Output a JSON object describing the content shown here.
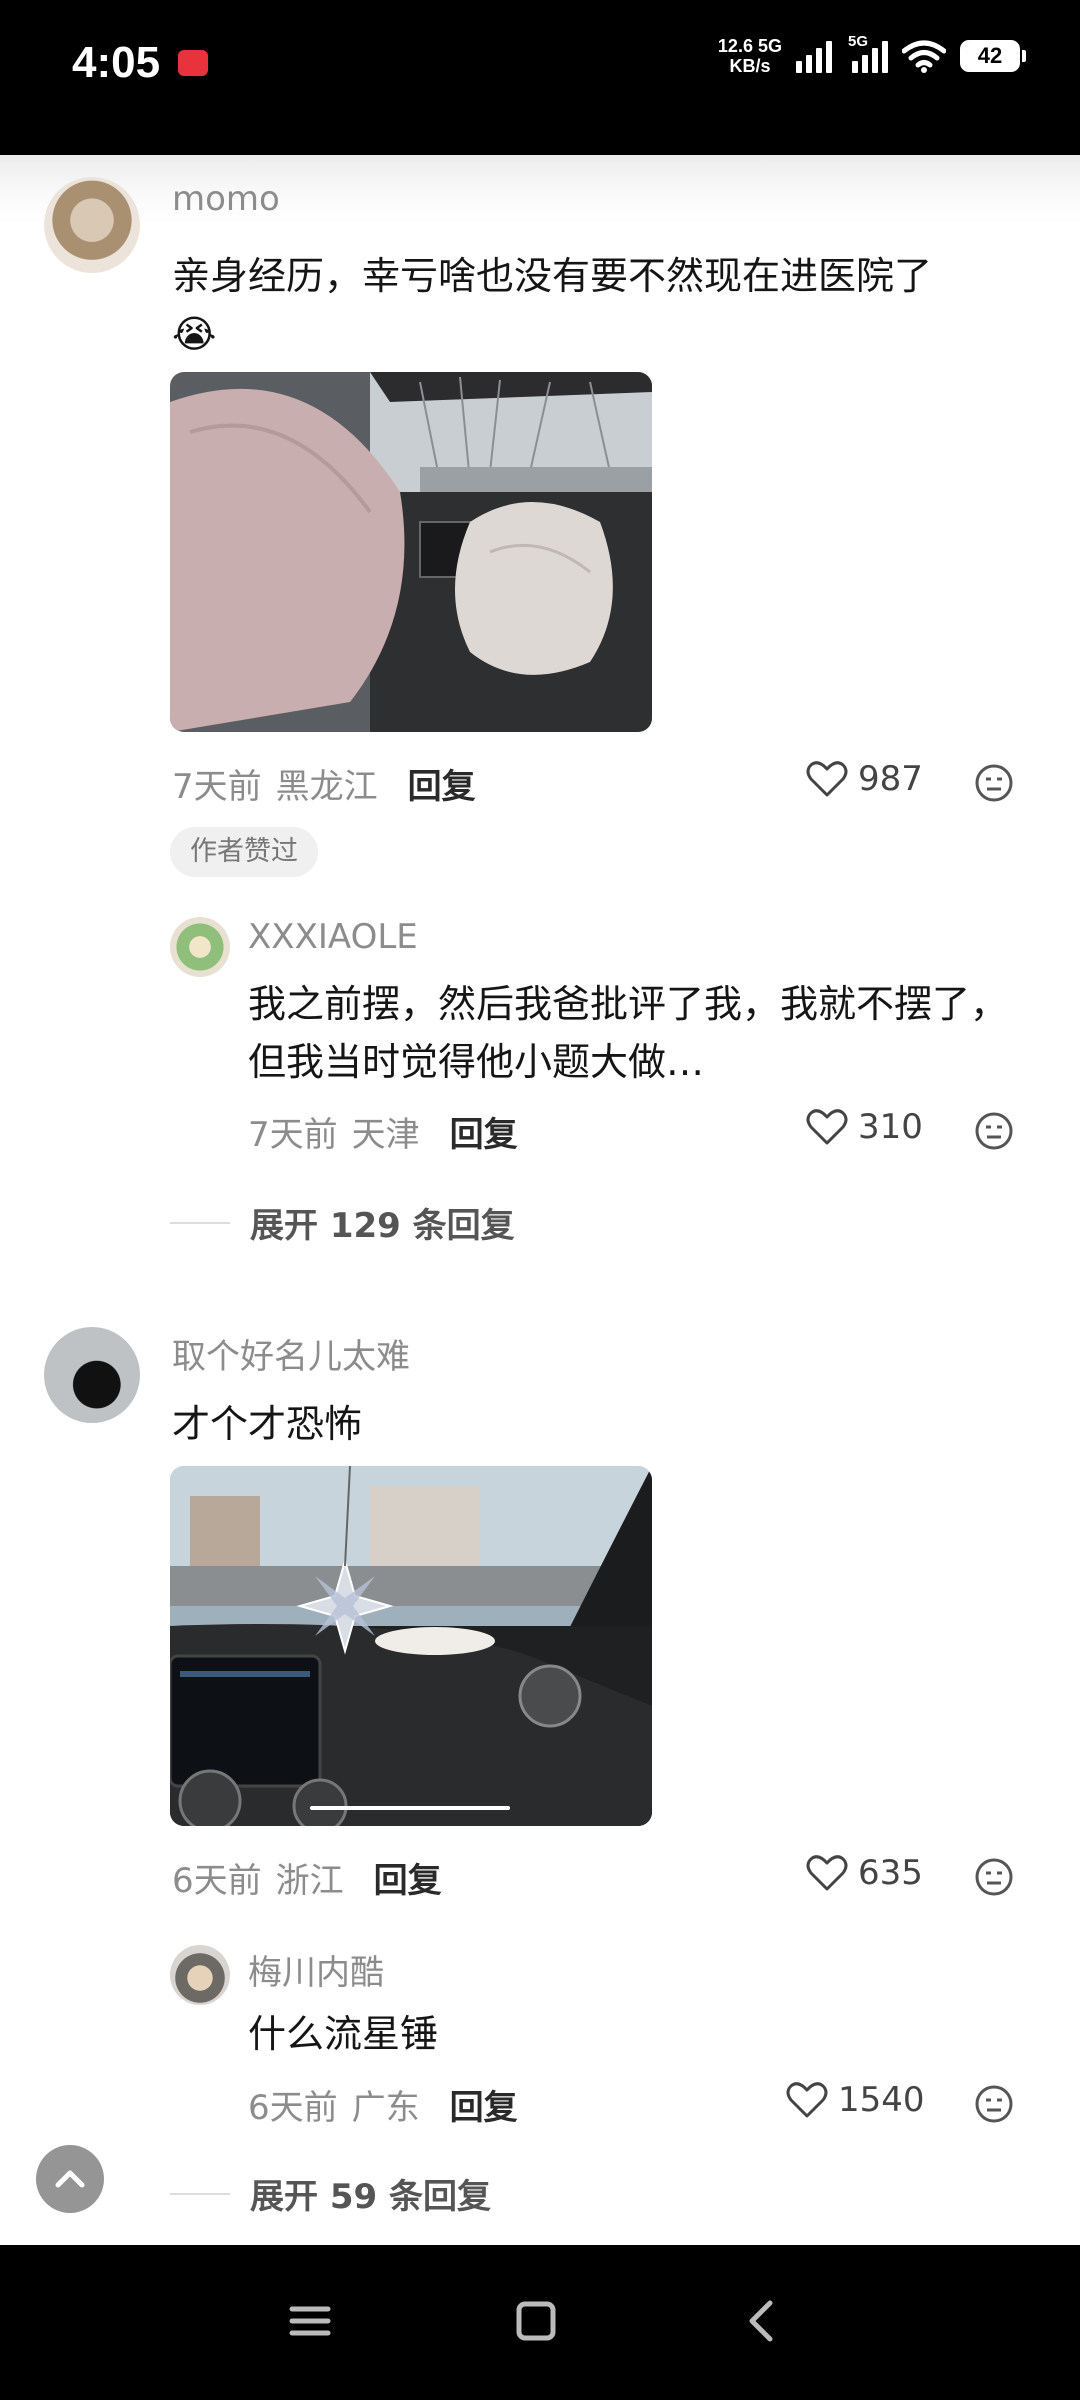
{
  "status_bar": {
    "time": "4:05",
    "speed_value": "12.6",
    "speed_unit": "KB/s",
    "network": "5G",
    "battery": "42"
  },
  "comments": [
    {
      "username": "momo",
      "text": "亲身经历，幸亏啥也没有要不然现在进医院了",
      "emoji": "😭",
      "time": "7天前",
      "location": "黑龙江",
      "reply_label": "回复",
      "likes": "987",
      "author_tag": "作者赞过",
      "sub_reply": {
        "username": "XXXIAOLE",
        "text": "我之前摆，然后我爸批评了我，我就不摆了，但我当时觉得他小题大做…",
        "time": "7天前",
        "location": "天津",
        "reply_label": "回复",
        "likes": "310"
      },
      "expand_label": "展开 129 条回复"
    },
    {
      "username": "取个好名儿太难",
      "text": "才个才恐怖",
      "time": "6天前",
      "location": "浙江",
      "reply_label": "回复",
      "likes": "635",
      "sub_reply": {
        "username": "梅川内酷",
        "text": "什么流星锤",
        "time": "6天前",
        "location": "广东",
        "reply_label": "回复",
        "likes": "1540"
      },
      "expand_label": "展开 59 条回复"
    }
  ],
  "nav": {
    "icons": [
      "menu-icon",
      "home-square-icon",
      "back-icon"
    ]
  }
}
